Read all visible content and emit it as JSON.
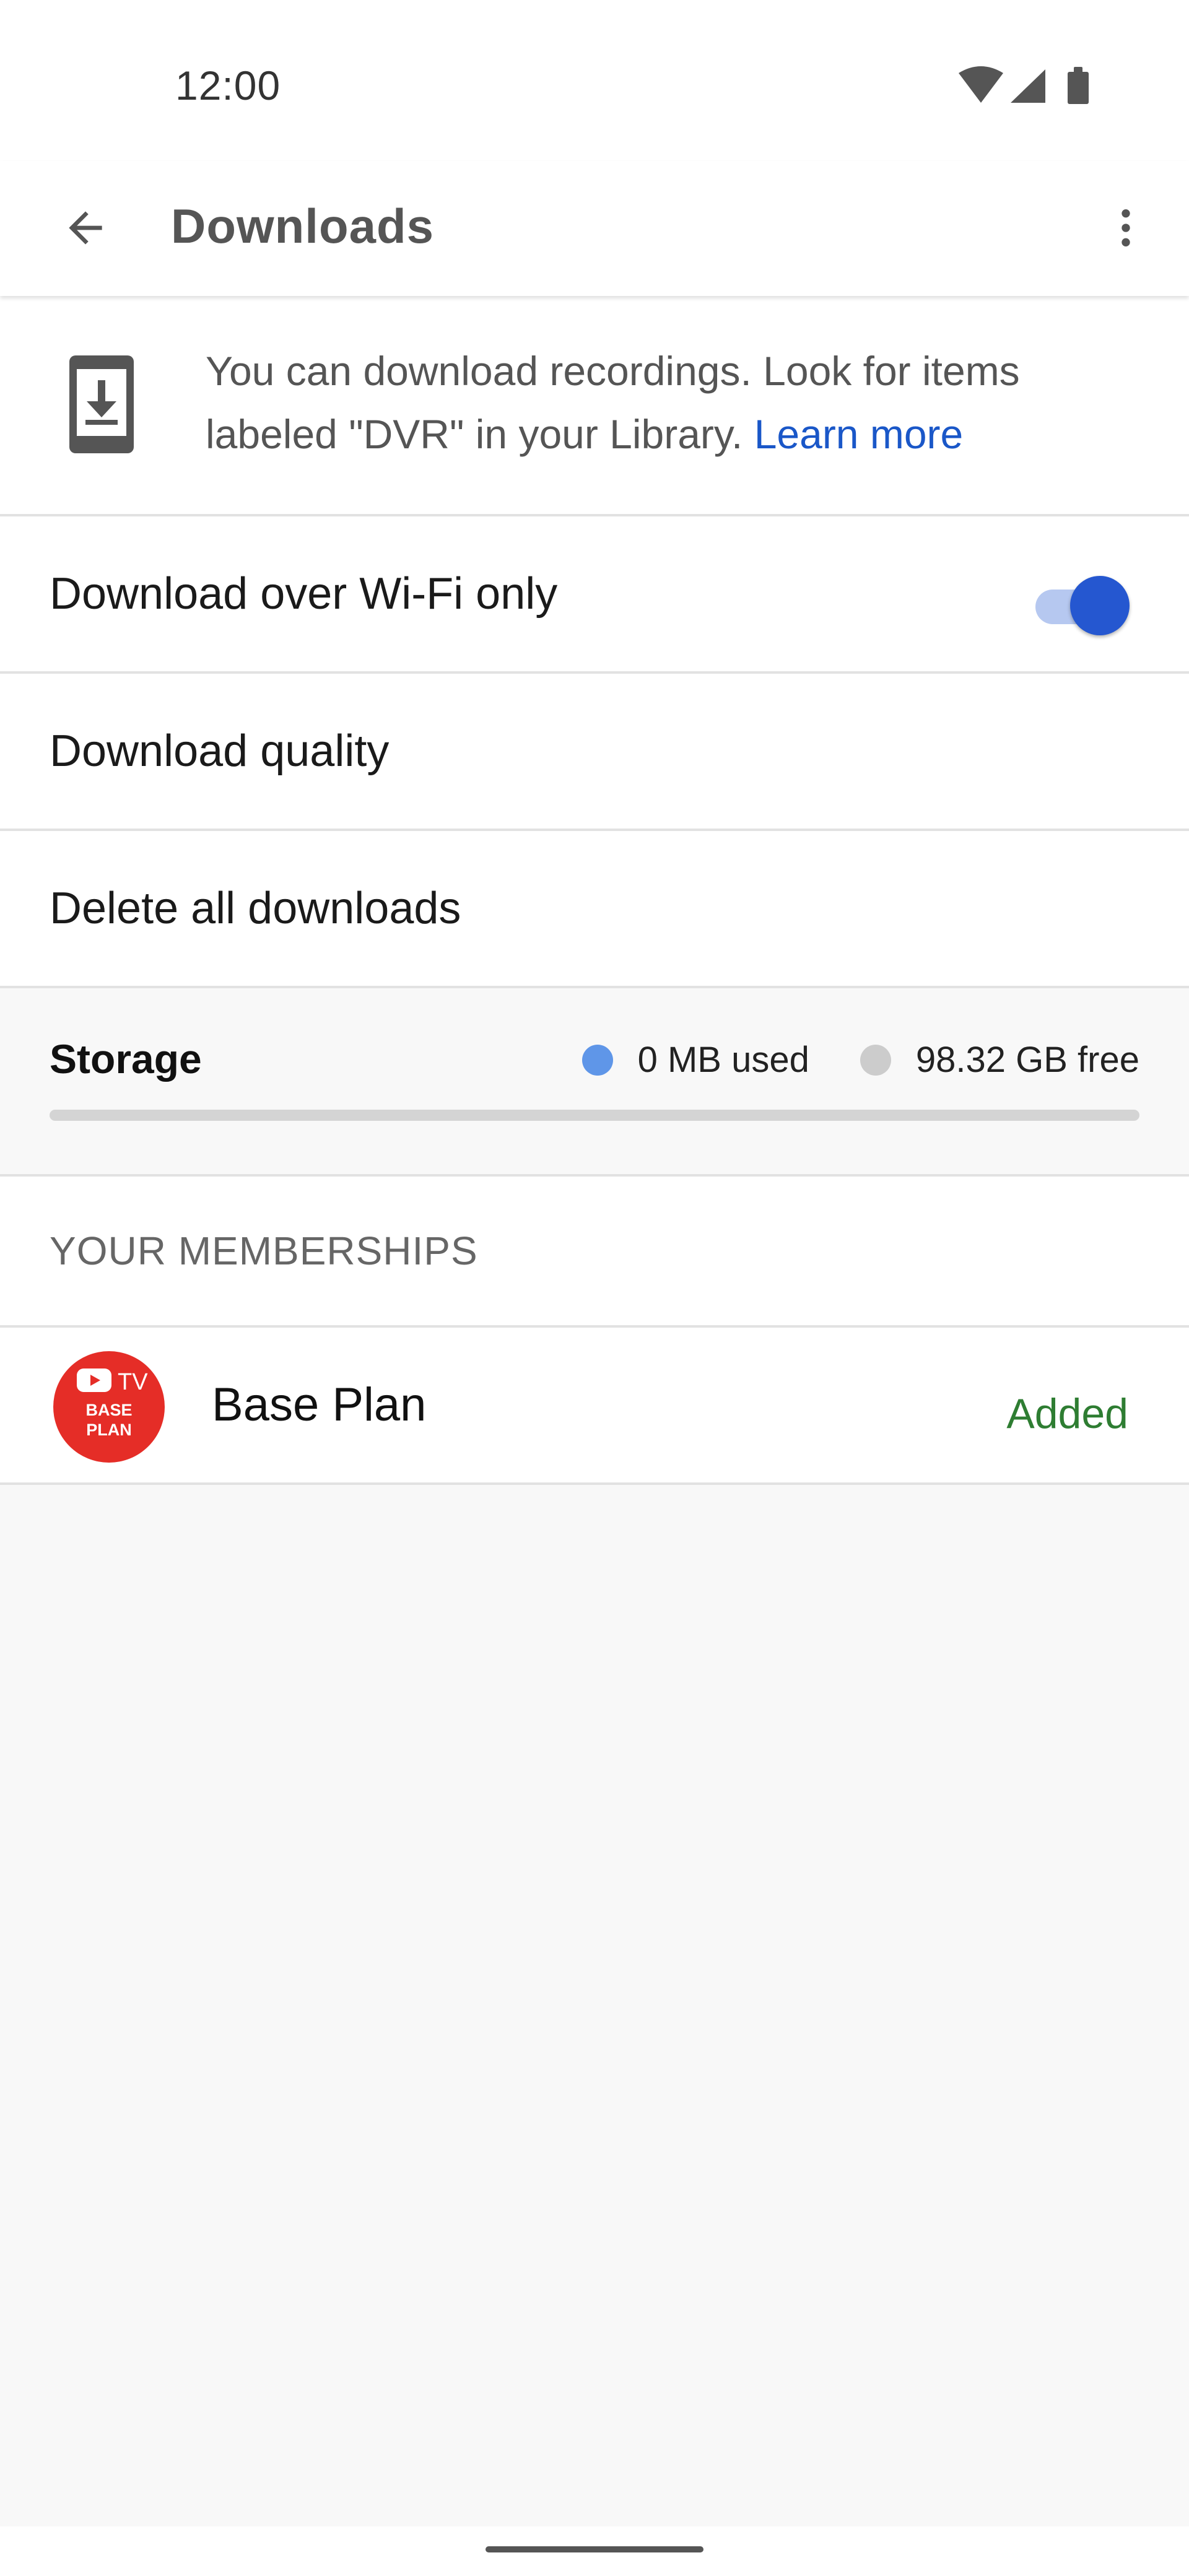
{
  "status_bar": {
    "time": "12:00",
    "icons": [
      "wifi-icon",
      "cellular-signal-icon",
      "battery-icon"
    ]
  },
  "app_bar": {
    "back_icon": "arrow-back-icon",
    "title": "Downloads",
    "more_icon": "more-vert-icon"
  },
  "info": {
    "icon": "phone-download-icon",
    "text": "You can download recordings. Look for items labeled \"DVR\" in your Library.",
    "link": "Learn more"
  },
  "settings": {
    "wifi_only_label": "Download over Wi-Fi only",
    "wifi_only_enabled": true,
    "quality_label": "Download quality",
    "delete_label": "Delete all downloads"
  },
  "storage": {
    "title": "Storage",
    "used_label": "0 MB used",
    "free_label": "98.32 GB free",
    "used_fraction": 0.0
  },
  "memberships": {
    "header": "YOUR MEMBERSHIPS",
    "items": [
      {
        "logo_text_top": "TV",
        "logo_text_line1": "BASE",
        "logo_text_line2": "PLAN",
        "name": "Base Plan",
        "status": "Added"
      }
    ]
  },
  "colors": {
    "accent": "#2557d0",
    "link": "#1a57c8",
    "added": "#2e7d32",
    "used_dot": "#5f96e8",
    "free_dot": "#cccccc",
    "logo_red": "#e52d27"
  }
}
